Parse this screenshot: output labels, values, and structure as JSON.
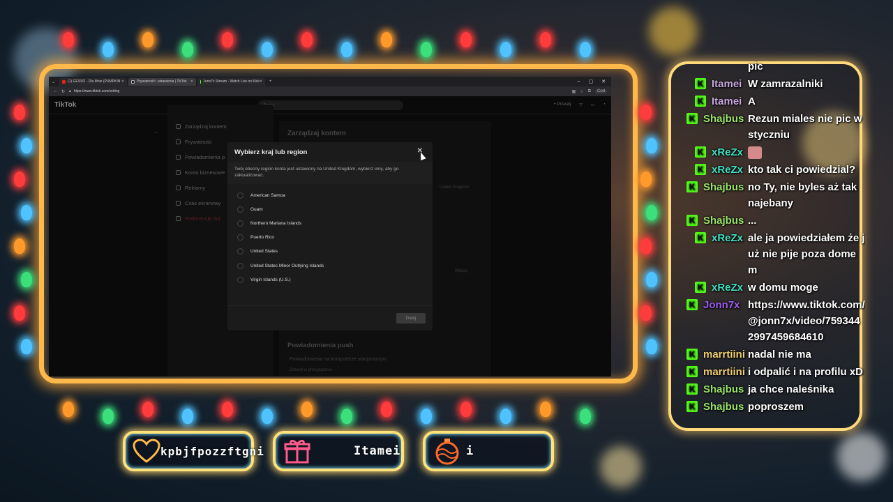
{
  "browser": {
    "tabs": [
      {
        "label": "(1) GESSO - Dla Mnie (PUMPKIN",
        "icon": "youtube-icon",
        "active": false
      },
      {
        "label": "Prywatność i ustawienia | TikTok",
        "icon": "tiktok-icon",
        "active": true
      },
      {
        "label": "Jonn7x Stream - Watch Live on Kick",
        "icon": "kick-icon",
        "active": false
      }
    ],
    "url": "https://www.tiktok.com/setting",
    "profile_label": "Cod"
  },
  "tiktok": {
    "logo": "TikTok",
    "search_placeholder": "Szukaj",
    "upload_label": "+ Prześlij",
    "sidebar": [
      {
        "label": "Zarządzaj kontem",
        "danger": false
      },
      {
        "label": "Prywatność",
        "danger": false
      },
      {
        "label": "Powiadomienia p",
        "danger": false
      },
      {
        "label": "Konto biznesowe",
        "danger": false
      },
      {
        "label": "Reklamy",
        "danger": false
      },
      {
        "label": "Czas ekranowy",
        "danger": false
      },
      {
        "label": "Preferencje dot",
        "danger": true
      }
    ],
    "main_title": "Zarządzaj kontem",
    "bg_value_region": "United Kingdom",
    "bg_value_more": "Więcej",
    "push_title": "Powiadomienia push",
    "push_subtitle": "Powiadomienia na komputerze stacjonarnym",
    "push_sub2": "Zezwól w przeglądarce"
  },
  "modal": {
    "title": "Wybierz kraj lub region",
    "description": "Twój obecny region konta jest ustawiony na United Kingdom, wybierz inny, aby go zaktualizować.",
    "options": [
      "American Samoa",
      "Guam",
      "Northern Mariana Islands",
      "Puerto Rico",
      "United States",
      "United States Minor Outlying Islands",
      "Virgin Islands (U.S.)"
    ],
    "next_label": "Dalej"
  },
  "alerts": {
    "follower": "kpbjfpozzftgni",
    "sub": "Itamei",
    "donation": "i"
  },
  "chat": [
    {
      "user": "",
      "text": "pic",
      "color": "#ffffff",
      "indent": false,
      "badge": false
    },
    {
      "user": "Itamei",
      "text": "W zamrazalniki",
      "color": "#c9a8e0",
      "indent": true,
      "badge": true
    },
    {
      "user": "Itamei",
      "text": "A",
      "color": "#c9a8e0",
      "indent": true,
      "badge": true
    },
    {
      "user": "Shajbus",
      "text": "Rezun miales nie pic w styczniu",
      "color": "#9be36a",
      "indent": false,
      "badge": true
    },
    {
      "user": "xReZx",
      "text": "",
      "color": "#3ee0c0",
      "indent": true,
      "badge": true,
      "emote": true
    },
    {
      "user": "xReZx",
      "text": "kto tak ci powiedzial?",
      "color": "#3ee0c0",
      "indent": true,
      "badge": true
    },
    {
      "user": "Shajbus",
      "text": "no Ty, nie byles aż tak najebany",
      "color": "#9be36a",
      "indent": false,
      "badge": true
    },
    {
      "user": "Shajbus",
      "text": "...",
      "color": "#9be36a",
      "indent": false,
      "badge": true
    },
    {
      "user": "xReZx",
      "text": "ale ja powiedziałem że już nie pije poza domem",
      "color": "#3ee0c0",
      "indent": true,
      "badge": true
    },
    {
      "user": "xReZx",
      "text": "w domu moge",
      "color": "#3ee0c0",
      "indent": true,
      "badge": true
    },
    {
      "user": "Jonn7x",
      "text": "https://www.tiktok.com/@jonn7x/video/7593442997459684610",
      "color": "#9c5cf0",
      "indent": false,
      "badge": true
    },
    {
      "user": "marrtiini",
      "text": "nadal nie ma",
      "color": "#f0d070",
      "indent": false,
      "badge": true
    },
    {
      "user": "marrtiini",
      "text": "i odpalić i na profilu xD",
      "color": "#f0d070",
      "indent": false,
      "badge": true
    },
    {
      "user": "Shajbus",
      "text": "ja chce naleśnika",
      "color": "#9be36a",
      "indent": false,
      "badge": true
    },
    {
      "user": "Shajbus",
      "text": "poproszem",
      "color": "#9be36a",
      "indent": false,
      "badge": true
    }
  ]
}
